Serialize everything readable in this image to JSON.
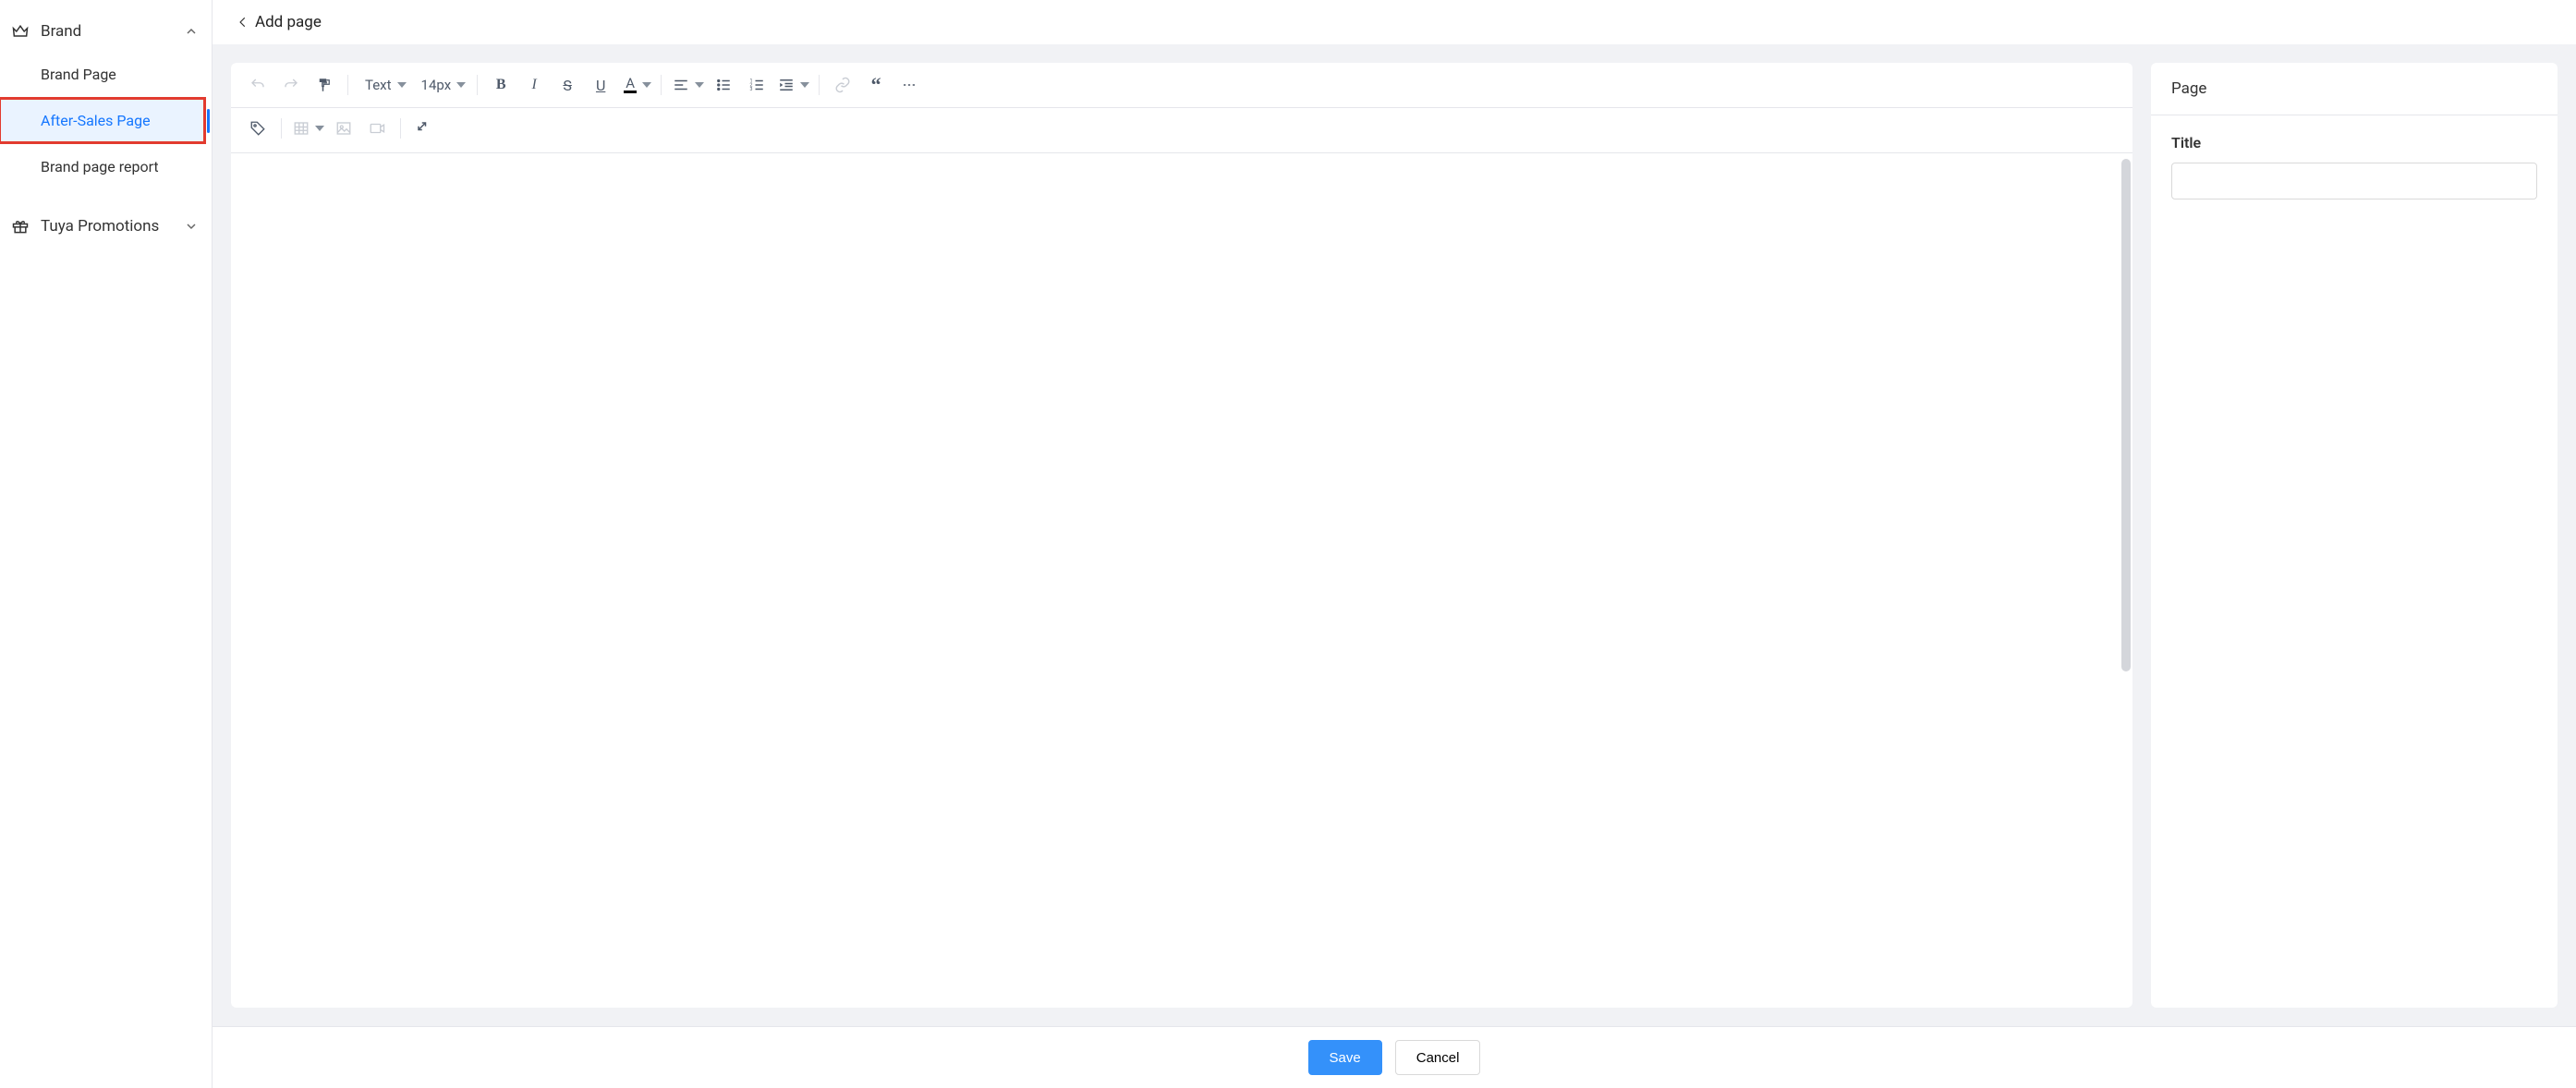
{
  "sidebar": {
    "categories": [
      {
        "label": "Brand",
        "expanded": true,
        "items": [
          {
            "label": "Brand Page",
            "active": false
          },
          {
            "label": "After-Sales Page",
            "active": true,
            "highlight": true
          },
          {
            "label": "Brand page report",
            "active": false
          }
        ]
      },
      {
        "label": "Tuya Promotions",
        "expanded": false,
        "items": []
      }
    ]
  },
  "header": {
    "title": "Add page"
  },
  "toolbar": {
    "style_label": "Text",
    "size_label": "14px"
  },
  "side_panel": {
    "header": "Page",
    "title_label": "Title",
    "title_value": ""
  },
  "footer": {
    "save_label": "Save",
    "cancel_label": "Cancel"
  }
}
